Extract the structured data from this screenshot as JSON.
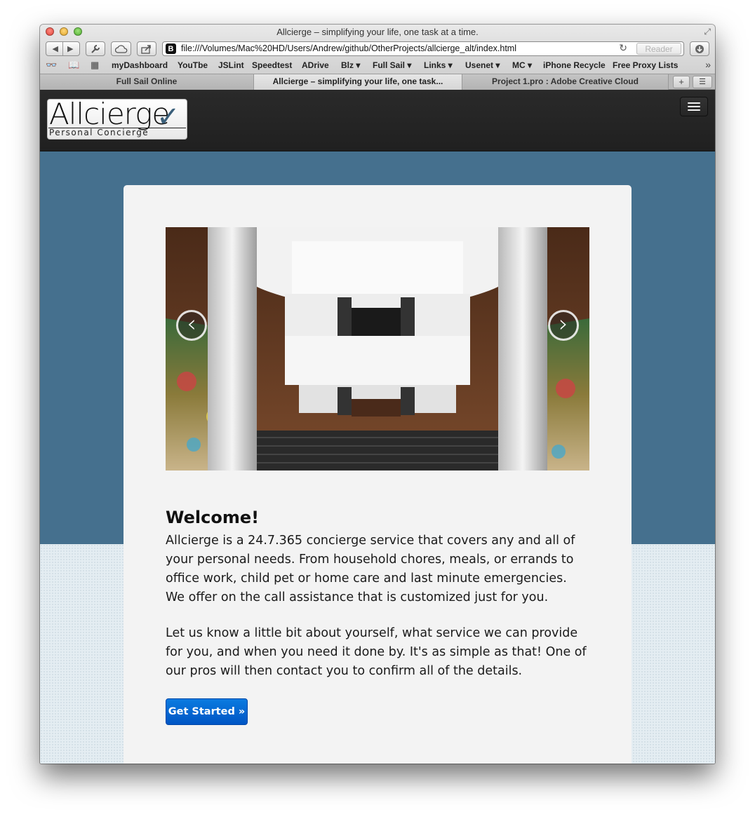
{
  "window": {
    "title": "Allcierge – simplifying your life, one task at a time."
  },
  "toolbar": {
    "url": "file:///Volumes/Mac%20HD/Users/Andrew/github/OtherProjects/allcierge_alt/index.html",
    "favicon_letter": "B",
    "reader_label": "Reader"
  },
  "bookmarks": [
    "myDashboard",
    "YouTbe",
    "JSLint",
    "Speedtest",
    "ADrive",
    "Blz ▾",
    "Full Sail ▾",
    "Links ▾",
    "Usenet ▾",
    "MC ▾",
    "iPhone Recycle",
    "Free Proxy Lists"
  ],
  "tabs": [
    {
      "label": "Full Sail Online"
    },
    {
      "label": "Allcierge – simplifying your life, one task..."
    },
    {
      "label": "Project 1.pro : Adobe Creative Cloud"
    }
  ],
  "site": {
    "logo_main": "Allcierge",
    "logo_check": "✓",
    "logo_sub": "Personal Concierge"
  },
  "carousel": {
    "prev_label": "‹",
    "next_label": "›"
  },
  "welcome": {
    "title": "Welcome!",
    "p1": "Allcierge is a 24.7.365 concierge service that covers any and all of your personal needs. From household chores, meals, or errands to office work, child pet or home care and last minute emergencies. We offer on the call assistance that is customized just for you.",
    "p2": "Let us know a little bit about yourself, what service we can provide for you, and when you need it done by. It's as simple as that! One of our pros will then contact you to confirm all of the details.",
    "button": "Get Started »"
  },
  "colors": {
    "header_bg": "#262626",
    "band_blue": "#45708e",
    "card_bg": "#f3f3f3",
    "button_blue": "#0a6fd6"
  }
}
